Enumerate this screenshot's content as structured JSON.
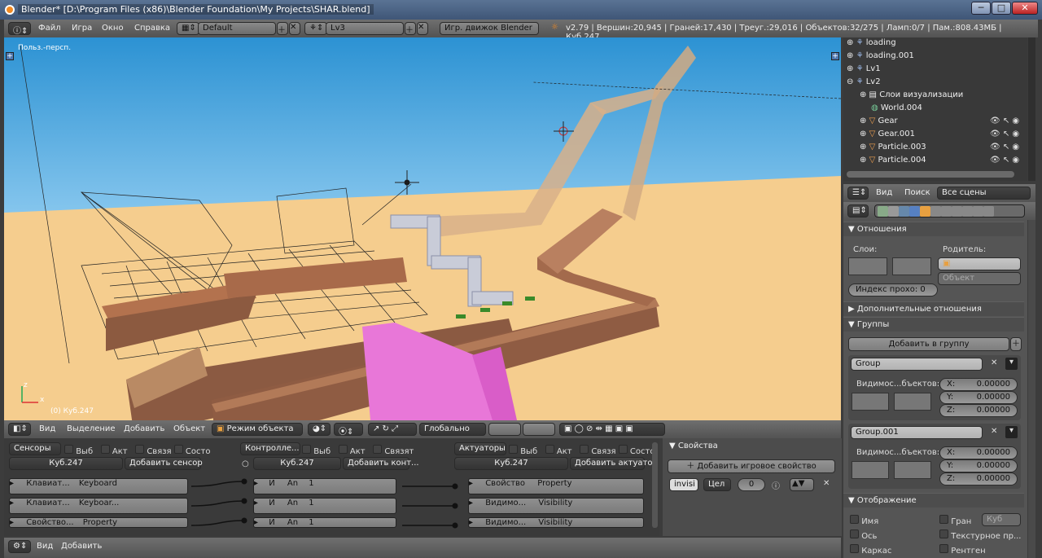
{
  "window": {
    "title": "Blender* [D:\\Program Files (x86)\\Blender Foundation\\My Projects\\SHAR.blend]",
    "min": "─",
    "max": "□",
    "close": "✕"
  },
  "menubar": {
    "items": [
      "Файл",
      "Игра",
      "Окно",
      "Справка"
    ],
    "screen": "Default",
    "scene": "Lv3",
    "engine": "Игр. движок Blender",
    "stats": "v2.79 | Вершин:20,945 | Граней:17,430 | Треуг.:29,016 | Объектов:32/275 | Ламп:0/7 | Пам.:808.43МБ | Куб.247"
  },
  "viewport": {
    "label": "Польз.-персп.",
    "object_label": "(0) Куб.247",
    "axis_x": "x",
    "axis_z": "z",
    "plus": "+"
  },
  "outliner": {
    "items": [
      {
        "label": "loading"
      },
      {
        "label": "loading.001"
      },
      {
        "label": "Lv1"
      },
      {
        "label": "Lv2"
      },
      {
        "label": "Слои визуализации"
      },
      {
        "label": "World.004"
      },
      {
        "label": "Gear"
      },
      {
        "label": "Gear.001"
      },
      {
        "label": "Particle.003"
      },
      {
        "label": "Particle.004"
      }
    ]
  },
  "outliner_header": {
    "view": "Вид",
    "search": "Поиск",
    "filter": "Все сцены"
  },
  "properties": {
    "relations_title": "Отношения",
    "layers_label": "Слои:",
    "parent_label": "Родитель:",
    "parent_type": "Объект",
    "pass_index": "Индекс прохо: 0",
    "extra_relations": "Дополнительные отношения",
    "groups_title": "Группы",
    "add_group": "Добавить в группу",
    "groups": [
      {
        "name": "Group",
        "vis_label": "Видимос...бъектов:",
        "x_label": "X:",
        "x": "0.00000",
        "y_label": "Y:",
        "y": "0.00000",
        "z_label": "Z:",
        "z": "0.00000"
      },
      {
        "name": "Group.001",
        "vis_label": "Видимос...бъектов:",
        "x_label": "X:",
        "x": "0.00000",
        "y_label": "Y:",
        "y": "0.00000",
        "z_label": "Z:",
        "z": "0.00000"
      }
    ],
    "display_title": "Отображение",
    "display_opts": [
      "Имя",
      "Ось",
      "Каркас"
    ],
    "display_opts2": [
      "Гран",
      "Текстурное пр...",
      "Рентген"
    ],
    "bound_type": "Куб"
  },
  "view_header": {
    "view": "Вид",
    "select": "Выделение",
    "add": "Добавить",
    "object": "Объект",
    "mode": "Режим объекта",
    "orientation": "Глобально"
  },
  "logic": {
    "sensors": {
      "title": "Сенсоры",
      "opts": [
        "Выб",
        "Акт",
        "Связя",
        "Состо"
      ],
      "object": "Куб.247",
      "add": "Добавить сенсор",
      "bricks": [
        {
          "name": "Клавиат...",
          "type": "Keyboard"
        },
        {
          "name": "Клавиат...",
          "type": "Keyboar..."
        },
        {
          "name": "Свойство...",
          "type": "Property"
        }
      ]
    },
    "controllers": {
      "title": "Контролле...",
      "opts": [
        "Выб",
        "Акт",
        "Связят"
      ],
      "object": "Куб.247",
      "add": "Добавить конт...",
      "bricks": [
        {
          "name": "И",
          "type": "An",
          "num": "1"
        },
        {
          "name": "И",
          "type": "An",
          "num": "1"
        },
        {
          "name": "И",
          "type": "An",
          "num": "1"
        }
      ]
    },
    "actuators": {
      "title": "Актуаторы",
      "opts": [
        "Выб",
        "Акт",
        "Связя",
        "Состо"
      ],
      "object": "Куб.247",
      "add": "Добавить актуатор",
      "bricks": [
        {
          "name": "Свойство",
          "type": "Property"
        },
        {
          "name": "Видимо...",
          "type": "Visibility"
        },
        {
          "name": "Видимо...",
          "type": "Visibility"
        }
      ]
    }
  },
  "game_props": {
    "title": "Свойства",
    "add": "Добавить игровое свойство",
    "prop_name": "invisi",
    "prop_type": "Цел",
    "prop_value": "0"
  },
  "bottom": {
    "view": "Вид",
    "add": "Добавить"
  },
  "colors": {
    "accent": "#5680c2",
    "sand": "#f5cd8e",
    "sky": "#2c92d3"
  }
}
